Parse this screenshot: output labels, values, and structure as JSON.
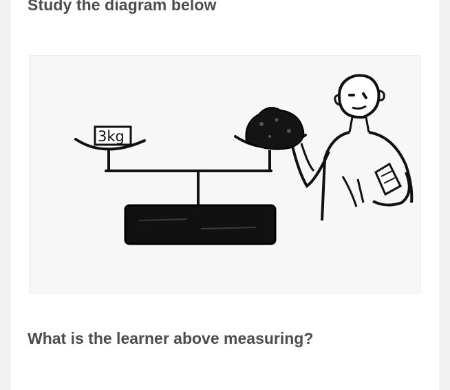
{
  "content": {
    "heading": "Study the diagram below",
    "question": "What is the learner above measuring?"
  },
  "diagram": {
    "weight_label": "3kg"
  }
}
